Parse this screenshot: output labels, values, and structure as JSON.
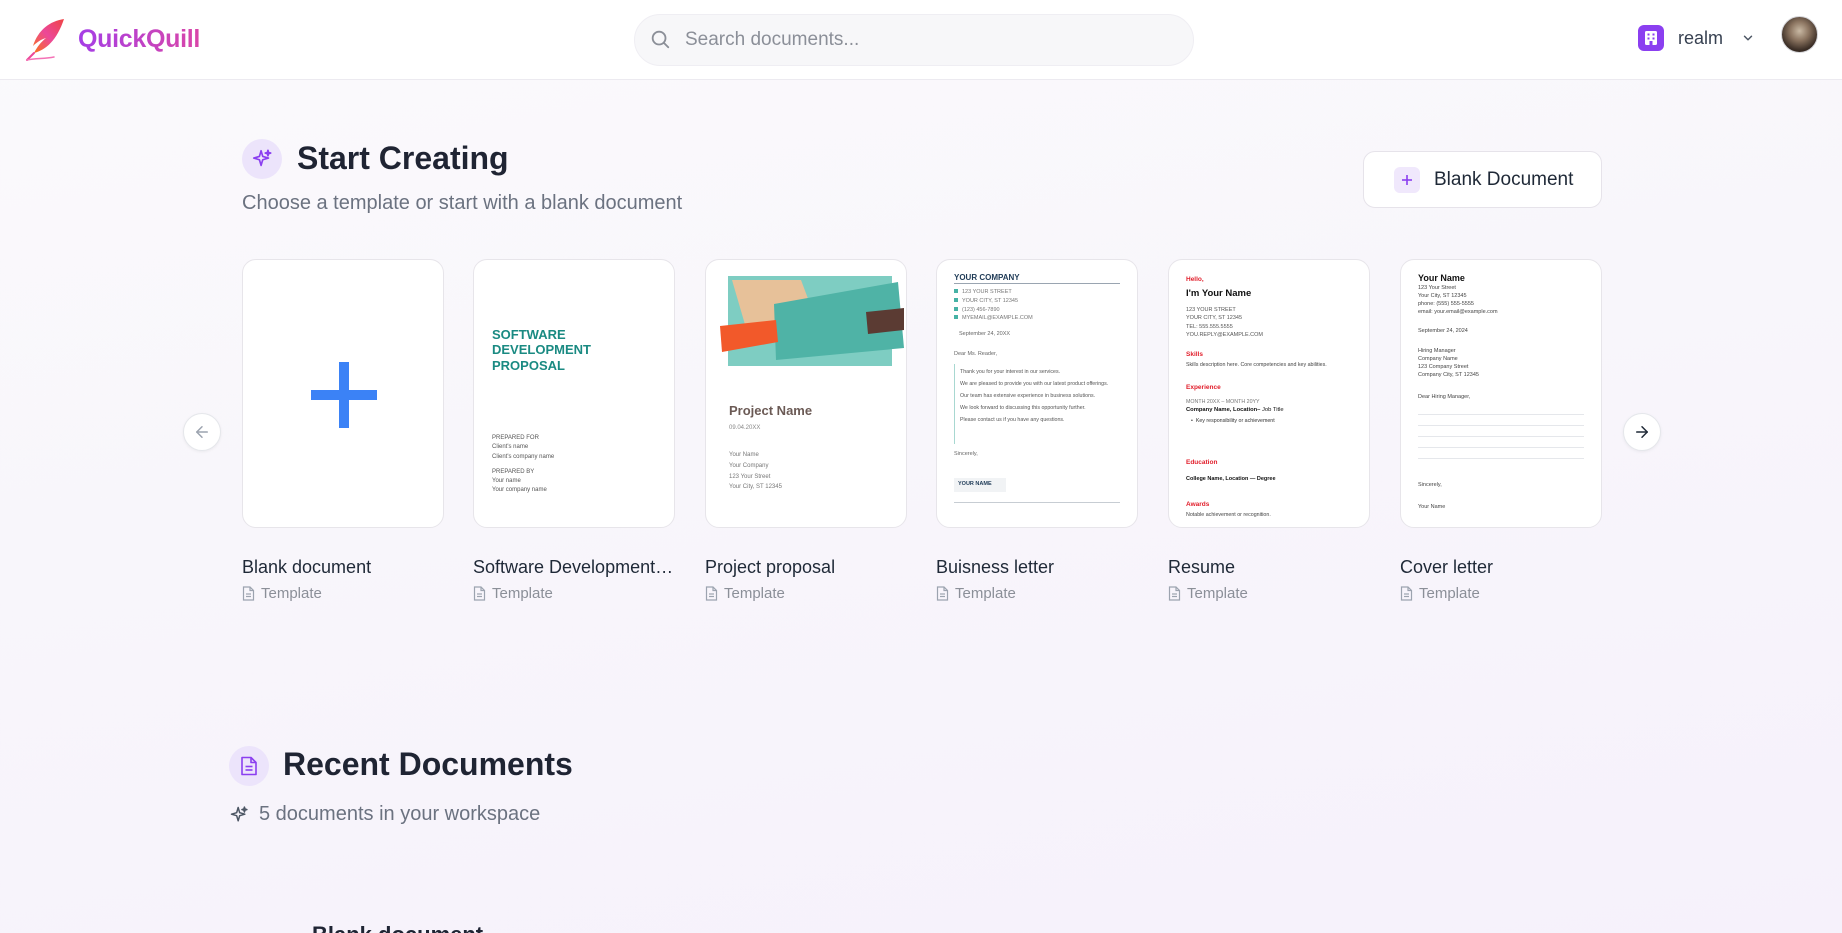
{
  "header": {
    "brand": "QuickQuill",
    "search_placeholder": "Search documents...",
    "workspace_name": "realm"
  },
  "start": {
    "title": "Start Creating",
    "subtitle": "Choose a template or start with a blank document",
    "blank_button": "Blank Document"
  },
  "templates": [
    {
      "title": "Blank document",
      "type": "Template"
    },
    {
      "title": "Software Development Proposal",
      "type": "Template"
    },
    {
      "title": "Project proposal",
      "type": "Template"
    },
    {
      "title": "Buisness letter",
      "type": "Template"
    },
    {
      "title": "Resume",
      "type": "Template"
    },
    {
      "title": "Cover letter",
      "type": "Template"
    }
  ],
  "previews": {
    "sdp": {
      "heading": [
        "SOFTWARE",
        "DEVELOPMENT",
        "PROPOSAL"
      ],
      "lines": [
        "PREPARED FOR",
        "Client's name",
        "Client's company name",
        "PREPARED BY",
        "Your name",
        "Your company name"
      ]
    },
    "project": {
      "name": "Project Name",
      "date": "09.04.20XX",
      "lines": [
        "Your Name",
        "Your Company",
        "123 Your Street",
        "Your City, ST 12345"
      ]
    },
    "business": {
      "company": "YOUR COMPANY",
      "address": [
        "123 YOUR STREET",
        "YOUR CITY, ST 12345",
        "(123) 456-7890",
        "MYEMAIL@EXAMPLE.COM"
      ],
      "date": "September 24, 20XX",
      "greeting": "Dear Ms. Reader,",
      "body": [
        "Thank you for your interest in our services.",
        "We are pleased to provide you with our latest product offerings.",
        "Our team has extensive experience in business solutions.",
        "We look forward to discussing this opportunity further.",
        "Please contact us if you have any questions."
      ],
      "closing": "Sincerely,",
      "signature": "YOUR NAME"
    },
    "resume": {
      "hello": "Hello,",
      "name": "I'm Your Name",
      "address": [
        "123 YOUR STREET",
        "YOUR CITY, ST 12345",
        "TEL: 555.555.5555",
        "YOU.REPLY@EXAMPLE.COM"
      ],
      "skills_h": "Skills",
      "skills": "Skills description here. Core competencies and key abilities.",
      "exp_h": "Experience",
      "exp_date": "MONTH 20XX – MONTH 20YY",
      "exp_company": "Company Name, Location–",
      "exp_title": " Job Title",
      "exp_bullet": "Key responsibility or achievement",
      "edu_h": "Education",
      "edu": "College Name, Location — Degree",
      "awards_h": "Awards",
      "awards": "Notable achievement or recognition."
    },
    "cover": {
      "name": "Your Name",
      "address": [
        "123 Your Street",
        "Your City, ST 12345",
        "phone: (555) 555-5555",
        "email: your.email@example.com"
      ],
      "date": "September 24, 2024",
      "recipient": [
        "Hiring Manager",
        "Company Name",
        "123 Company Street",
        "Company City, ST 12345"
      ],
      "greeting": "Dear Hiring Manager,",
      "closing": "Sincerely,",
      "signature": "Your Name"
    }
  },
  "recent": {
    "title": "Recent Documents",
    "subtitle": "5 documents in your workspace",
    "first_item_peek": "Blank document"
  },
  "colors": {
    "brand_start": "#a53ee6",
    "brand_end": "#d946a8",
    "accent": "#8b3ff0",
    "plus_blue": "#3b82f6"
  }
}
